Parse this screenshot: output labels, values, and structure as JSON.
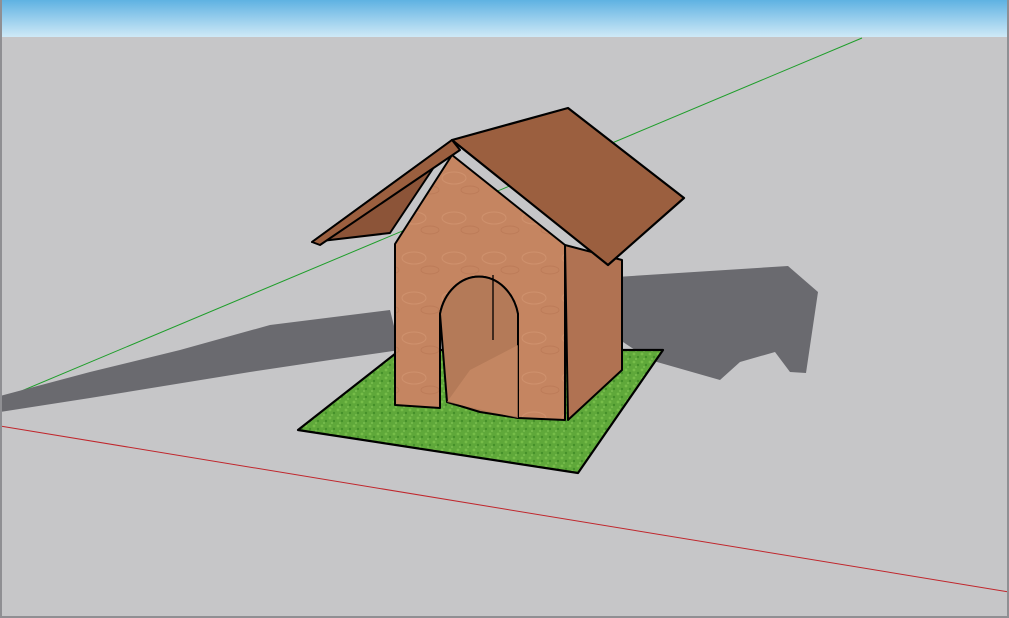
{
  "app": {
    "view": "3d-perspective",
    "model": "dog-house"
  },
  "colors": {
    "sky_top": "#5fb2e2",
    "sky_bottom": "#cfe9f7",
    "ground": "#c6c6c8",
    "x_axis": "#c0262c",
    "y_axis": "#1e9e2a",
    "shadow": "#6a6a6f",
    "wood_front": "#c58561",
    "wood_side": "#b07252",
    "roof": "#9b5f3f",
    "roof_underside": "#8c5438",
    "interior": "#b47a58",
    "grass": "#5fa83a",
    "edge": "#000000"
  },
  "icons": {
    "model": "dog-house-icon",
    "grass_pad": "grass-pad-icon"
  }
}
